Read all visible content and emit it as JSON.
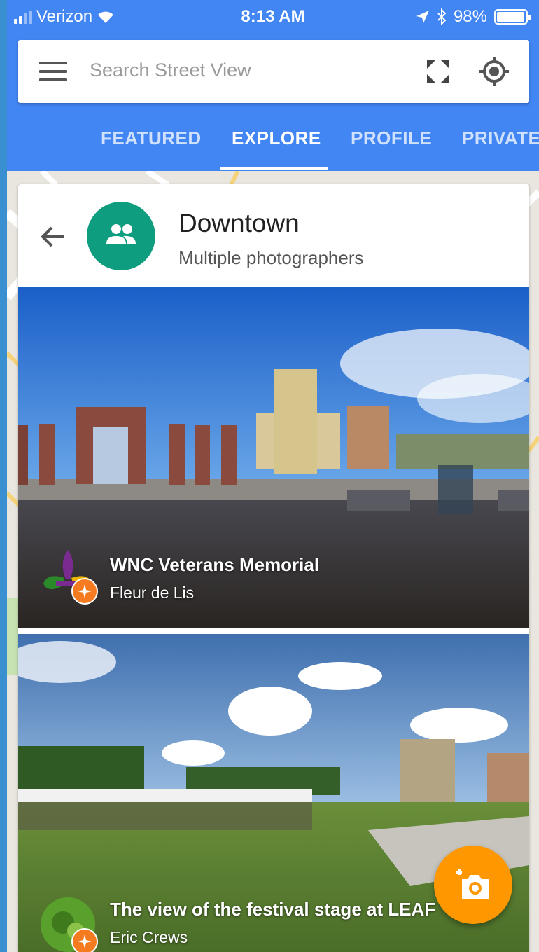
{
  "status_bar": {
    "carrier": "Verizon",
    "time": "8:13 AM",
    "battery_text": "98%",
    "battery_level": 0.98
  },
  "search": {
    "placeholder": "Search Street View"
  },
  "tabs": [
    {
      "label": "FEATURED",
      "active": false
    },
    {
      "label": "EXPLORE",
      "active": true
    },
    {
      "label": "PROFILE",
      "active": false
    },
    {
      "label": "PRIVATE",
      "active": false
    }
  ],
  "card": {
    "title": "Downtown",
    "subtitle": "Multiple photographers",
    "avatar_color": "#0f9d7f"
  },
  "photos": [
    {
      "title": "WNC Veterans Memorial",
      "author": "Fleur de Lis"
    },
    {
      "title": "The view of the festival stage at LEAF",
      "author": "Eric Crews"
    }
  ],
  "colors": {
    "header": "#4286f4",
    "fab": "#ff9800",
    "badge": "#f47b20"
  }
}
